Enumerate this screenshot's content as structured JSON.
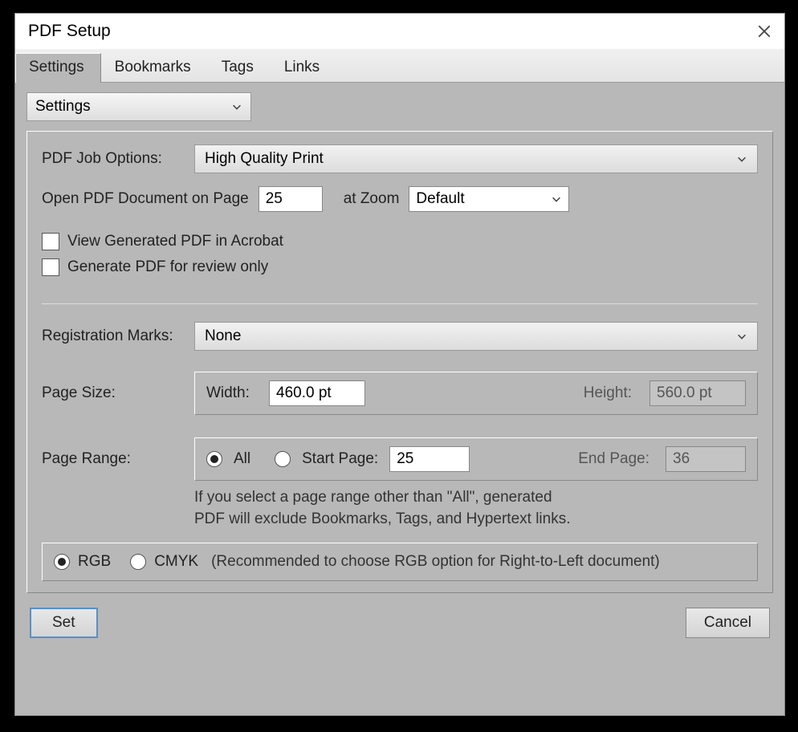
{
  "title": "PDF Setup",
  "tabs": [
    {
      "label": "Settings"
    },
    {
      "label": "Bookmarks"
    },
    {
      "label": "Tags"
    },
    {
      "label": "Links"
    }
  ],
  "settings_dropdown": "Settings",
  "form": {
    "job_options": {
      "label": "PDF Job Options:",
      "value": "High Quality Print"
    },
    "open_page": {
      "label": "Open PDF Document on Page",
      "value": "25"
    },
    "zoom": {
      "label": "at Zoom",
      "value": "Default"
    },
    "view_generated": "View Generated PDF in Acrobat",
    "review_only": "Generate PDF for review only",
    "reg_marks": {
      "label": "Registration Marks:",
      "value": "None"
    },
    "page_size": {
      "label": "Page Size:",
      "width_label": "Width:",
      "width_value": "460.0 pt",
      "height_label": "Height:",
      "height_value": "560.0 pt"
    },
    "page_range": {
      "label": "Page Range:",
      "all": "All",
      "start_label": "Start Page:",
      "start_value": "25",
      "end_label": "End Page:",
      "end_value": "36"
    },
    "note_line1": "If you select a page range other than \"All\",  generated",
    "note_line2": "PDF will exclude Bookmarks, Tags, and Hypertext links.",
    "color": {
      "rgb": "RGB",
      "cmyk": "CMYK",
      "recommend": "(Recommended to choose RGB option for Right-to-Left document)"
    }
  },
  "buttons": {
    "set": "Set",
    "cancel": "Cancel"
  }
}
